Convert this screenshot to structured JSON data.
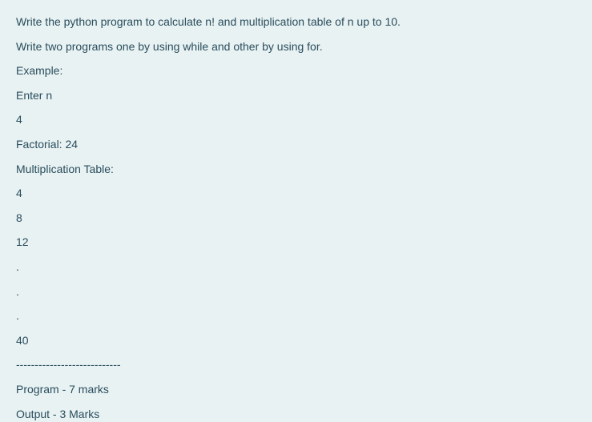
{
  "lines": [
    "Write the python program to calculate n! and multiplication table of n up to 10.",
    "Write two programs one by using while and other by using for.",
    "Example:",
    "Enter n",
    "4",
    "Factorial: 24",
    "Multiplication Table:",
    "4",
    "8",
    "12",
    ".",
    ".",
    ".",
    "40",
    "----------------------------",
    "Program - 7 marks",
    "Output - 3 Marks"
  ]
}
